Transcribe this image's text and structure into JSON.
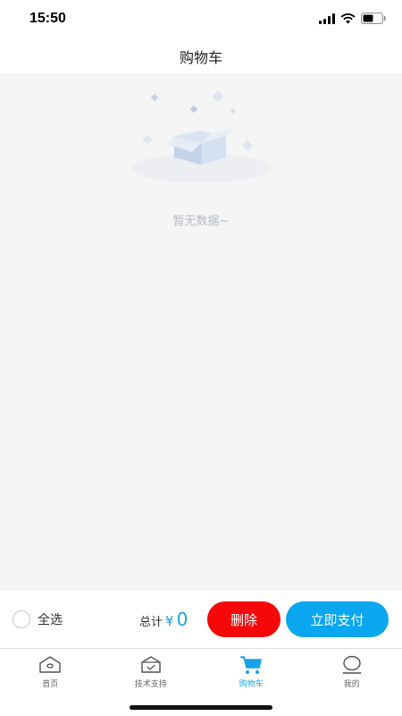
{
  "status_bar": {
    "time": "15:50"
  },
  "nav": {
    "title": "购物车"
  },
  "empty": {
    "text": "暂无数据~"
  },
  "action_bar": {
    "select_all_label": "全选",
    "total_label": "总计",
    "currency": "¥",
    "total_amount": "0",
    "delete_label": "删除",
    "pay_label": "立即支付"
  },
  "tabs": [
    {
      "label": "首页",
      "icon": "home-icon"
    },
    {
      "label": "技术支持",
      "icon": "support-icon"
    },
    {
      "label": "购物车",
      "icon": "cart-icon",
      "active": true
    },
    {
      "label": "我的",
      "icon": "profile-icon"
    }
  ],
  "colors": {
    "accent": "#1aa2e8",
    "delete": "#f60808",
    "pay": "#0aa6ef",
    "background": "#f5f5f6"
  }
}
